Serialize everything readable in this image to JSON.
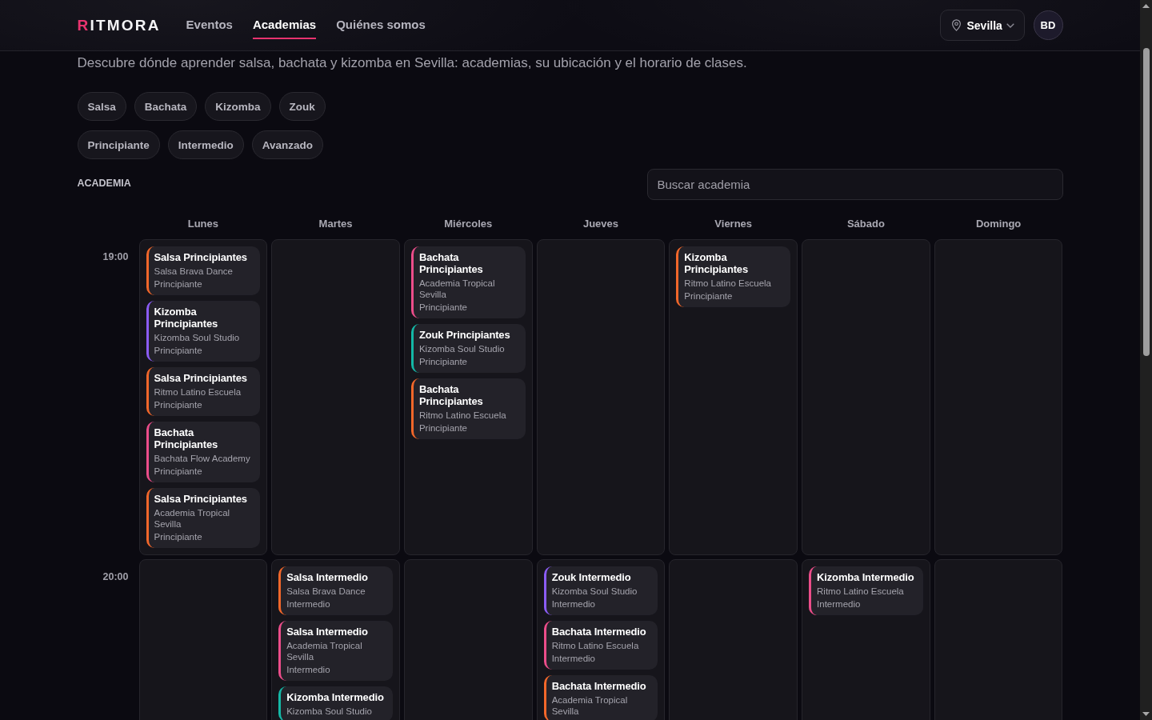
{
  "header": {
    "logo": "RITMORA",
    "nav": [
      {
        "label": "Eventos",
        "selected": false
      },
      {
        "label": "Academias",
        "selected": true
      },
      {
        "label": "Quiénes somos",
        "selected": false
      }
    ],
    "location": "Sevilla",
    "avatar": "BD"
  },
  "intro": "Descubre dónde aprender salsa, bachata y kizomba en Sevilla: academias, su ubicación y el horario de clases.",
  "filters": {
    "styles": [
      {
        "label": "Salsa",
        "selected": false
      },
      {
        "label": "Bachata",
        "selected": false
      },
      {
        "label": "Kizomba",
        "selected": false
      },
      {
        "label": "Zouk",
        "selected": false
      }
    ],
    "levels": [
      {
        "label": "Principiante",
        "selected": false
      },
      {
        "label": "Intermedio",
        "selected": false
      },
      {
        "label": "Avanzado",
        "selected": false
      }
    ]
  },
  "search": {
    "label": "ACADEMIA",
    "placeholder": "Buscar academia"
  },
  "schedule": {
    "days": [
      "Lunes",
      "Martes",
      "Miércoles",
      "Jueves",
      "Viernes",
      "Sábado",
      "Domingo"
    ],
    "rows": [
      {
        "time": "19:00",
        "cells": [
          {
            "classes": [
              {
                "title": "Salsa Principiantes",
                "academy": "Salsa Brava Dance",
                "level": "Principiante",
                "color": "#f2672a"
              },
              {
                "title": "Kizomba Principiantes",
                "academy": "Kizomba Soul Studio",
                "level": "Principiante",
                "color": "#8b5cf6"
              },
              {
                "title": "Salsa Principiantes",
                "academy": "Ritmo Latino Escuela",
                "level": "Principiante",
                "color": "#f2672a"
              },
              {
                "title": "Bachata Principiantes",
                "academy": "Bachata Flow Academy",
                "level": "Principiante",
                "color": "#ec4d8a"
              },
              {
                "title": "Salsa Principiantes",
                "academy": "Academia Tropical Sevilla",
                "level": "Principiante",
                "color": "#f2672a"
              }
            ]
          },
          {},
          {
            "classes": [
              {
                "title": "Bachata Principiantes",
                "academy": "Academia Tropical Sevilla",
                "level": "Principiante",
                "color": "#ec4d8a"
              },
              {
                "title": "Zouk Principiantes",
                "academy": "Kizomba Soul Studio",
                "level": "Principiante",
                "color": "#14b8a6"
              },
              {
                "title": "Bachata Principiantes",
                "academy": "Ritmo Latino Escuela",
                "level": "Principiante",
                "color": "#f2672a"
              }
            ]
          },
          {},
          {
            "classes": [
              {
                "title": "Kizomba Principiantes",
                "academy": "Ritmo Latino Escuela",
                "level": "Principiante",
                "color": "#f2672a"
              }
            ]
          },
          {},
          {}
        ]
      },
      {
        "time": "20:00",
        "cells": [
          {},
          {
            "classes": [
              {
                "title": "Salsa Intermedio",
                "academy": "Salsa Brava Dance",
                "level": "Intermedio",
                "color": "#f2672a"
              },
              {
                "title": "Salsa Intermedio",
                "academy": "Academia Tropical Sevilla",
                "level": "Intermedio",
                "color": "#ec4d8a"
              },
              {
                "title": "Kizomba Intermedio",
                "academy": "Kizomba Soul Studio",
                "color": "#14b8a6"
              }
            ]
          },
          {},
          {
            "classes": [
              {
                "title": "Zouk Intermedio",
                "academy": "Kizomba Soul Studio",
                "level": "Intermedio",
                "color": "#8b5cf6"
              },
              {
                "title": "Bachata Intermedio",
                "academy": "Ritmo Latino Escuela",
                "level": "Intermedio",
                "color": "#ec4d8a"
              },
              {
                "title": "Bachata Intermedio",
                "academy": "Academia Tropical Sevilla",
                "color": "#f2672a"
              }
            ]
          },
          {},
          {
            "classes": [
              {
                "title": "Kizomba Intermedio",
                "academy": "Ritmo Latino Escuela",
                "level": "Intermedio",
                "color": "#ec4d8a"
              }
            ]
          },
          {}
        ]
      }
    ]
  }
}
